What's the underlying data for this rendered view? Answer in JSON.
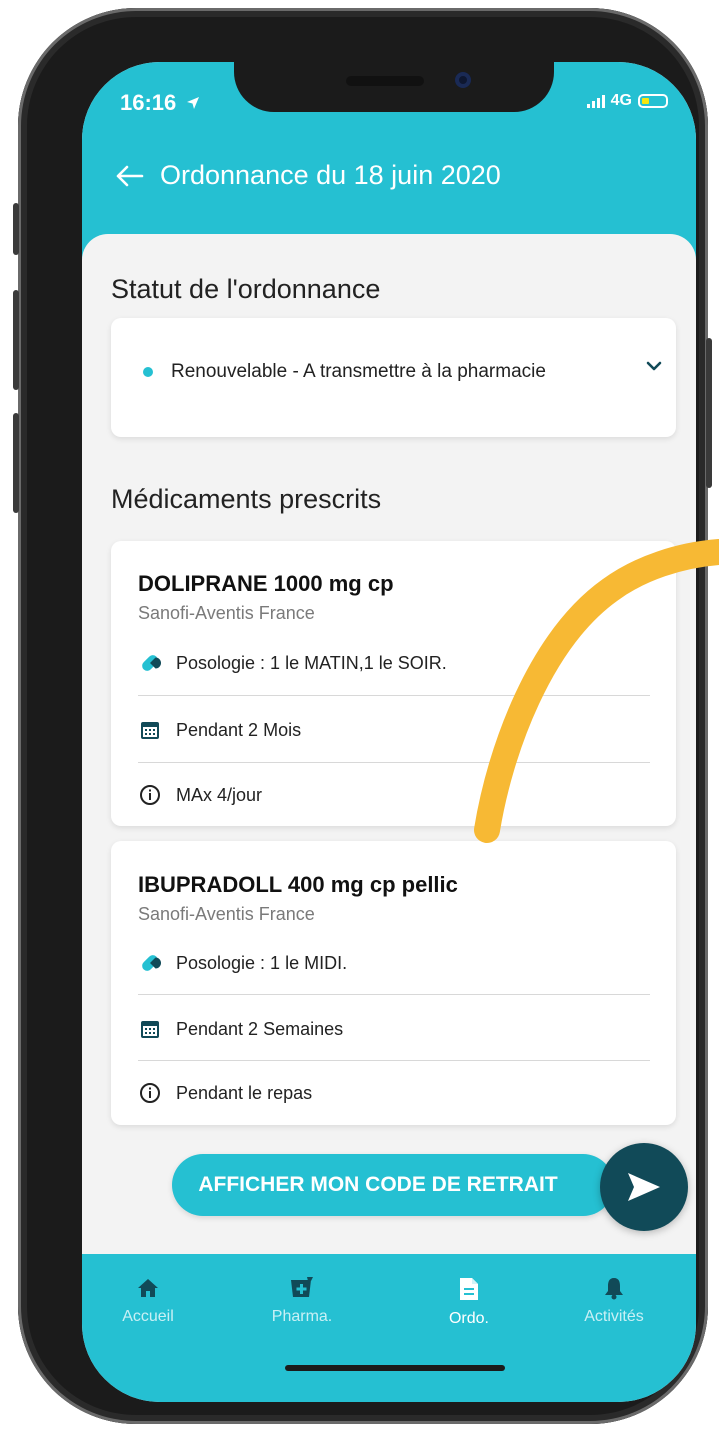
{
  "status_bar": {
    "time": "16:16",
    "network": "4G"
  },
  "header": {
    "title": "Ordonnance du 18 juin 2020",
    "back_icon": "arrow-left-icon"
  },
  "status_section": {
    "title": "Statut de l'ordonnance",
    "value": "Renouvelable - A transmettre à la pharmacie"
  },
  "meds_section": {
    "title": "Médicaments prescrits",
    "items": [
      {
        "name": "DOLIPRANE 1000 mg cp",
        "lab": "Sanofi-Aventis France",
        "posologie": "Posologie : 1 le MATIN,1 le SOIR.",
        "duree": "Pendant 2 Mois",
        "info": "MAx 4/jour"
      },
      {
        "name": "IBUPRADOLL 400 mg cp pellic",
        "lab": "Sanofi-Aventis France",
        "posologie": "Posologie : 1 le MIDI.",
        "duree": "Pendant 2 Semaines",
        "info": "Pendant le repas"
      }
    ]
  },
  "cta": {
    "label": "AFFICHER MON CODE DE RETRAIT"
  },
  "tabbar": {
    "tabs": [
      {
        "label": "Accueil",
        "icon": "home-icon",
        "active": false
      },
      {
        "label": "Pharma.",
        "icon": "pharmacy-icon",
        "active": false
      },
      {
        "label": "Ordo.",
        "icon": "document-icon",
        "active": true
      },
      {
        "label": "Activités",
        "icon": "bell-icon",
        "active": false
      }
    ]
  },
  "colors": {
    "accent": "#25c0d2",
    "dark": "#114a58",
    "annotation": "#f7b934"
  }
}
